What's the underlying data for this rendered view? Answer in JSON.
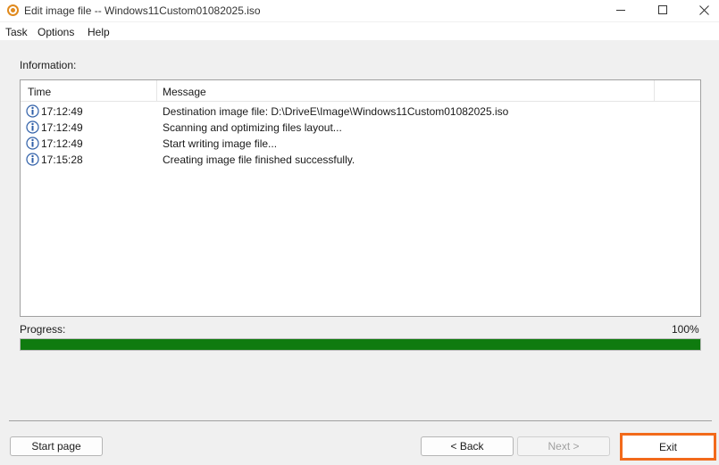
{
  "window": {
    "title": "Edit image file -- Windows11Custom01082025.iso",
    "controls": [
      "minimize-icon",
      "maximize-icon",
      "close-icon"
    ]
  },
  "menu": {
    "items": [
      {
        "label": "Task"
      },
      {
        "label": "Options"
      },
      {
        "label": "Help"
      }
    ]
  },
  "info": {
    "label": "Information:",
    "columns": {
      "time": "Time",
      "message": "Message"
    },
    "rows": [
      {
        "icon": "info-icon",
        "time": "17:12:49",
        "message": "Destination image file:  D:\\DriveE\\Image\\Windows11Custom01082025.iso"
      },
      {
        "icon": "info-icon",
        "time": "17:12:49",
        "message": "Scanning and optimizing files layout..."
      },
      {
        "icon": "info-icon",
        "time": "17:12:49",
        "message": "Start writing image file..."
      },
      {
        "icon": "info-icon",
        "time": "17:15:28",
        "message": "Creating image file finished successfully."
      }
    ]
  },
  "progress": {
    "label": "Progress:",
    "percent_text": "100%",
    "value": 1.0,
    "color": "#0f7b0f"
  },
  "buttons": {
    "start_page": "Start page",
    "back": "< Back",
    "next": "Next >",
    "exit": "Exit"
  },
  "highlight_color": "#f26a1b"
}
